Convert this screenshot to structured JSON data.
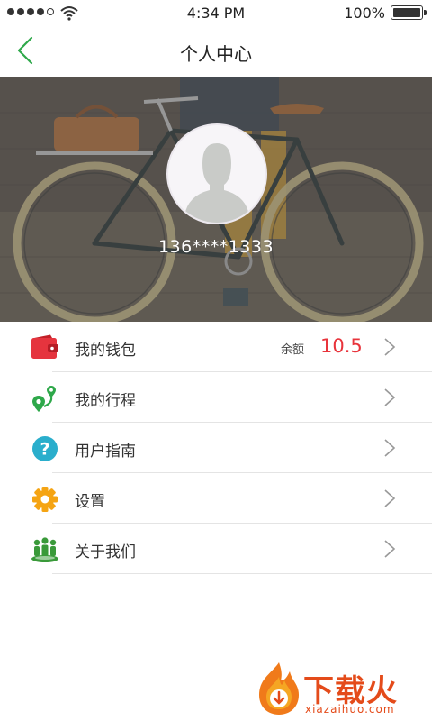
{
  "status_bar": {
    "time": "4:34 PM",
    "battery": "100%"
  },
  "nav": {
    "title": "个人中心"
  },
  "profile": {
    "phone": "136****1333"
  },
  "menu": {
    "items": [
      {
        "label": "我的钱包",
        "icon": "wallet-icon"
      },
      {
        "label": "我的行程",
        "icon": "route-pin-icon"
      },
      {
        "label": "用户指南",
        "icon": "help-icon"
      },
      {
        "label": "设置",
        "icon": "gear-icon"
      },
      {
        "label": "关于我们",
        "icon": "team-icon"
      }
    ],
    "balance_label": "余额",
    "balance_value": "10.5"
  },
  "watermark": {
    "name": "下载火",
    "url": "xiazaihuo.com"
  },
  "colors": {
    "accent_green": "#2ea84a",
    "balance_red": "#e8343c",
    "wallet_red": "#e5343e",
    "help_teal": "#2aaecc",
    "gear_orange": "#f5a413",
    "team_green": "#3a9a3a"
  }
}
